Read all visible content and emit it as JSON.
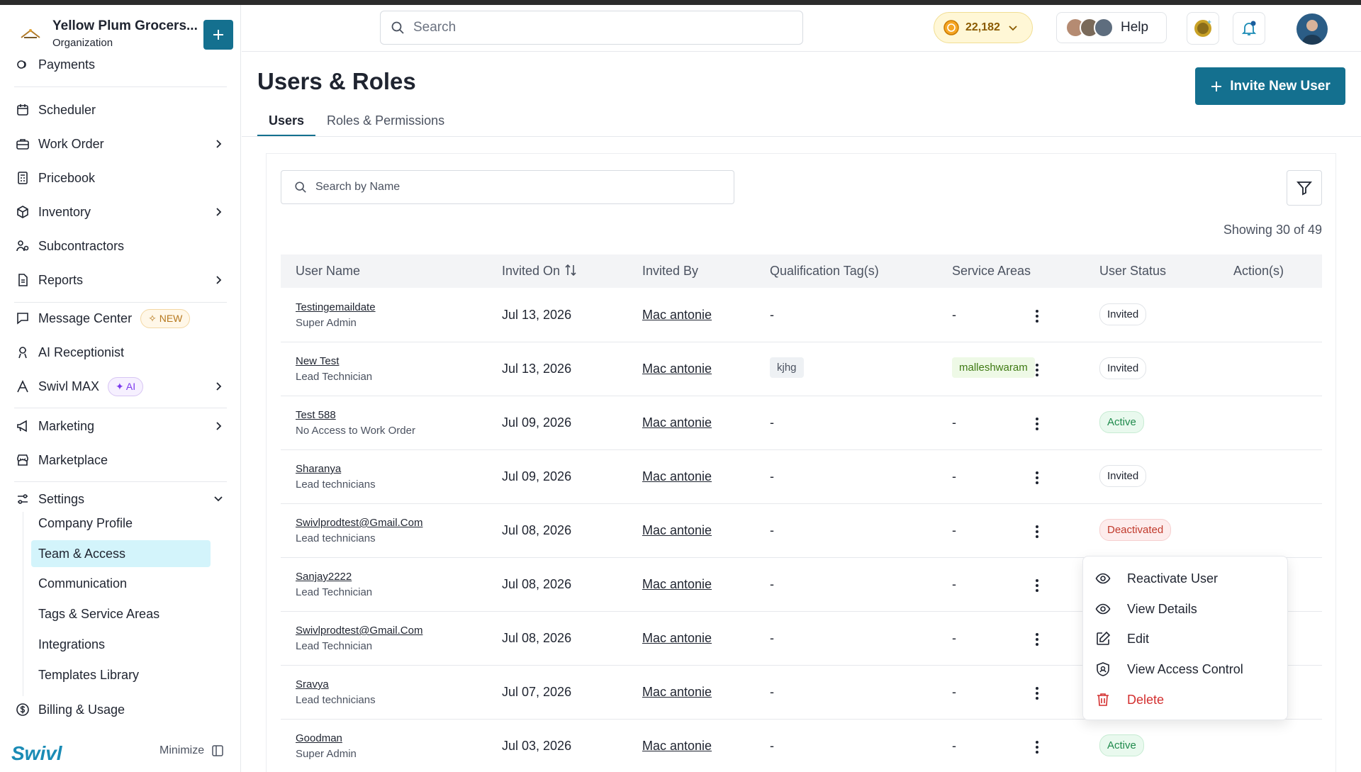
{
  "org": {
    "name": "Yellow Plum Grocers...",
    "subtitle": "Organization"
  },
  "sidebar": {
    "items": [
      {
        "label": "Payments",
        "icon": "payments-icon"
      },
      {
        "label": "Scheduler",
        "icon": "calendar-icon"
      },
      {
        "label": "Work Order",
        "icon": "briefcase-icon",
        "expandable": true
      },
      {
        "label": "Pricebook",
        "icon": "pricebook-icon"
      },
      {
        "label": "Inventory",
        "icon": "box-icon",
        "expandable": true
      },
      {
        "label": "Subcontractors",
        "icon": "users-icon"
      },
      {
        "label": "Reports",
        "icon": "report-icon",
        "expandable": true
      },
      {
        "label": "Message Center",
        "icon": "message-icon",
        "badge": "NEW"
      },
      {
        "label": "AI Receptionist",
        "icon": "receptionist-icon"
      },
      {
        "label": "Swivl MAX",
        "icon": "max-icon",
        "badge": "AI",
        "expandable": true
      },
      {
        "label": "Marketing",
        "icon": "megaphone-icon",
        "expandable": true
      },
      {
        "label": "Marketplace",
        "icon": "store-icon"
      },
      {
        "label": "Settings",
        "icon": "settings-icon",
        "expanded": true
      }
    ],
    "settings_sub": [
      "Company Profile",
      "Team & Access",
      "Communication",
      "Tags & Service Areas",
      "Integrations",
      "Templates Library"
    ],
    "active_sub": "Team & Access",
    "billing": "Billing & Usage",
    "brand": "Swivl",
    "minimize": "Minimize"
  },
  "header": {
    "search_placeholder": "Search",
    "coins": "22,182",
    "help": "Help"
  },
  "page": {
    "title": "Users & Roles",
    "invite_button": "Invite New User",
    "tabs": [
      "Users",
      "Roles & Permissions"
    ],
    "active_tab": "Users",
    "search_placeholder": "Search by Name",
    "showing": "Showing 30 of 49"
  },
  "table": {
    "columns": [
      "User Name",
      "Invited On",
      "Invited By",
      "Qualification Tag(s)",
      "Service Areas",
      "User Status",
      "Action(s)"
    ],
    "rows": [
      {
        "name": "Testingemaildate",
        "role": "Super Admin",
        "invited_on": "Jul 13, 2026",
        "invited_by": "Mac antonie",
        "qual": "-",
        "area": "-",
        "status": "Invited"
      },
      {
        "name": "New Test",
        "role": "Lead Technician",
        "invited_on": "Jul 13, 2026",
        "invited_by": "Mac antonie",
        "qual": "kjhg",
        "area": "malleshwaram",
        "status": "Invited"
      },
      {
        "name": "Test 588",
        "role": "No Access to Work Order",
        "invited_on": "Jul 09, 2026",
        "invited_by": "Mac antonie",
        "qual": "-",
        "area": "-",
        "status": "Active"
      },
      {
        "name": "Sharanya",
        "role": "Lead technicians",
        "invited_on": "Jul 09, 2026",
        "invited_by": "Mac antonie",
        "qual": "-",
        "area": "-",
        "status": "Invited"
      },
      {
        "name": "Swivlprodtest@Gmail.Com",
        "role": "Lead technicians",
        "invited_on": "Jul 08, 2026",
        "invited_by": "Mac antonie",
        "qual": "-",
        "area": "-",
        "status": "Deactivated"
      },
      {
        "name": "Sanjay2222",
        "role": "Lead Technician",
        "invited_on": "Jul 08, 2026",
        "invited_by": "Mac antonie",
        "qual": "-",
        "area": "-",
        "status": ""
      },
      {
        "name": "Swivlprodtest@Gmail.Com",
        "role": "Lead Technician",
        "invited_on": "Jul 08, 2026",
        "invited_by": "Mac antonie",
        "qual": "-",
        "area": "-",
        "status": ""
      },
      {
        "name": "Sravya",
        "role": "Lead technicians",
        "invited_on": "Jul 07, 2026",
        "invited_by": "Mac antonie",
        "qual": "-",
        "area": "-",
        "status": ""
      },
      {
        "name": "Goodman",
        "role": "Super Admin",
        "invited_on": "Jul 03, 2026",
        "invited_by": "Mac antonie",
        "qual": "-",
        "area": "-",
        "status": "Active"
      }
    ]
  },
  "context_menu": {
    "items": [
      {
        "label": "Reactivate User",
        "icon": "eye-icon"
      },
      {
        "label": "View Details",
        "icon": "eye-icon"
      },
      {
        "label": "Edit",
        "icon": "edit-icon"
      },
      {
        "label": "View Access Control",
        "icon": "shield-icon"
      },
      {
        "label": "Delete",
        "icon": "trash-icon",
        "danger": true
      }
    ]
  },
  "colors": {
    "accent": "#14708f",
    "active_sub_bg": "#d3f4fb",
    "danger": "#d32f2f",
    "status_active": "#1f8a4c"
  }
}
